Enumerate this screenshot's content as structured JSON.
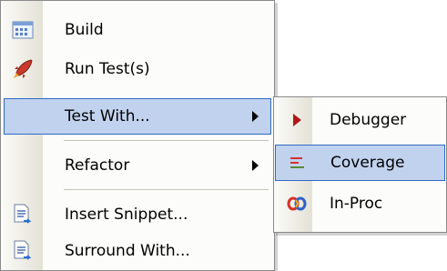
{
  "main_menu": {
    "items": [
      {
        "label": "Build",
        "icon": "build-icon"
      },
      {
        "label": "Run Test(s)",
        "icon": "rocket-icon"
      },
      {
        "label": "Test With...",
        "icon": "",
        "submenu": true,
        "highlighted": true
      },
      {
        "label": "Refactor",
        "icon": "",
        "submenu": true
      },
      {
        "label": "Insert Snippet...",
        "icon": "snippet-icon"
      },
      {
        "label": "Surround With...",
        "icon": "snippet-icon"
      }
    ]
  },
  "sub_menu": {
    "items": [
      {
        "label": "Debugger",
        "icon": "debugger-icon"
      },
      {
        "label": "Coverage",
        "icon": "coverage-icon",
        "highlighted": true
      },
      {
        "label": "In-Proc",
        "icon": "inproc-icon"
      }
    ]
  },
  "colors": {
    "highlight": "#c1d2ee",
    "highlight_border": "#316ac5"
  }
}
